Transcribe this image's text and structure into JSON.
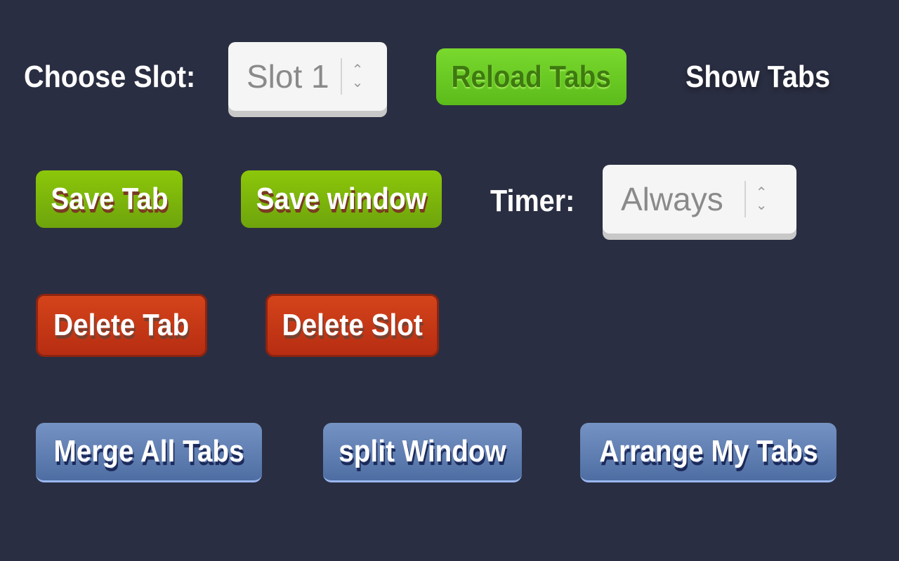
{
  "row1": {
    "choose_slot_label": "Choose Slot:",
    "slot_select_value": "Slot 1",
    "reload_tabs": "Reload Tabs",
    "show_tabs": "Show Tabs"
  },
  "row2": {
    "save_tab": "Save Tab",
    "save_window": "Save window",
    "timer_label": "Timer:",
    "timer_select_value": "Always"
  },
  "row3": {
    "delete_tab": "Delete Tab",
    "delete_slot": "Delete Slot"
  },
  "row4": {
    "merge_all_tabs": "Merge All Tabs",
    "split_window": "split Window",
    "arrange_my_tabs": "Arrange My Tabs"
  },
  "colors": {
    "background": "#2a2e42",
    "green": "#8cc70a",
    "lime": "#79d92e",
    "red": "#c9391a",
    "blue": "#6583b8"
  }
}
